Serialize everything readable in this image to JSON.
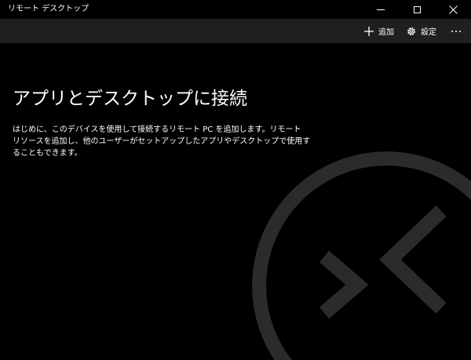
{
  "window": {
    "title": "リモート デスクトップ",
    "controls": [
      "minimize-icon",
      "maximize-icon",
      "close-icon"
    ]
  },
  "commandbar": {
    "add_label": "追加",
    "settings_label": "設定",
    "add_icon": "plus-icon",
    "settings_icon": "gear-icon",
    "more_icon": "more-icon"
  },
  "main": {
    "headline": "アプリとデスクトップに接続",
    "description": "はじめに、このデバイスを使用して接続するリモート PC を追加します。リモート リソースを追加し、他のユーザーがセットアップしたアプリやデスクトップで使用することもできます。"
  },
  "colors": {
    "background": "#000000",
    "commandbar": "#1f1f1f",
    "logo": "#2b2b2b",
    "text": "#ffffff"
  }
}
